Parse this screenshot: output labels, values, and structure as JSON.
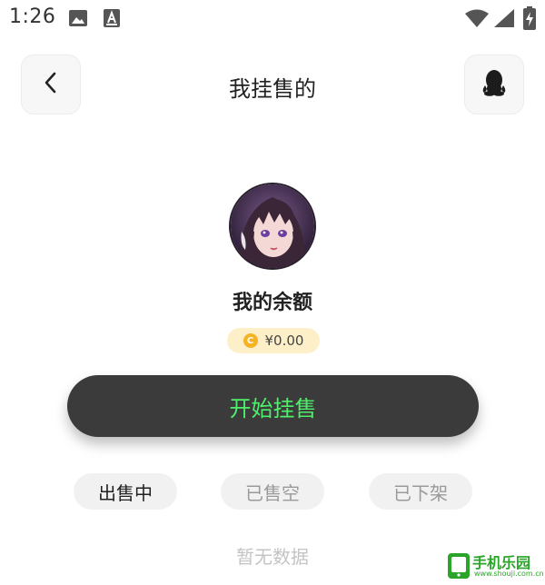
{
  "status_bar": {
    "time": "1:26",
    "icons": [
      "image-icon",
      "font-icon",
      "wifi-icon",
      "signal-icon",
      "battery-charging-icon"
    ]
  },
  "header": {
    "title": "我挂售的",
    "left_icon": "back-icon",
    "right_icon": "qq-icon"
  },
  "profile": {
    "balance_title": "我的余额",
    "balance_amount": "¥0.00",
    "coin_icon": "coin-icon",
    "coin_symbol": "C"
  },
  "actions": {
    "start_label": "开始挂售"
  },
  "tabs": [
    {
      "label": "出售中",
      "active": true
    },
    {
      "label": "已售空",
      "active": false
    },
    {
      "label": "已下架",
      "active": false
    }
  ],
  "empty_state": "暂无数据",
  "watermark": {
    "text": "手机乐园",
    "sub": "www.shouji.com.cn"
  },
  "colors": {
    "start_button_bg": "#3b3b3b",
    "start_button_text": "#4ef06a",
    "badge_bg": "#fdf0c9",
    "coin": "#f5b323",
    "tab_bg": "#f1f1f1"
  }
}
